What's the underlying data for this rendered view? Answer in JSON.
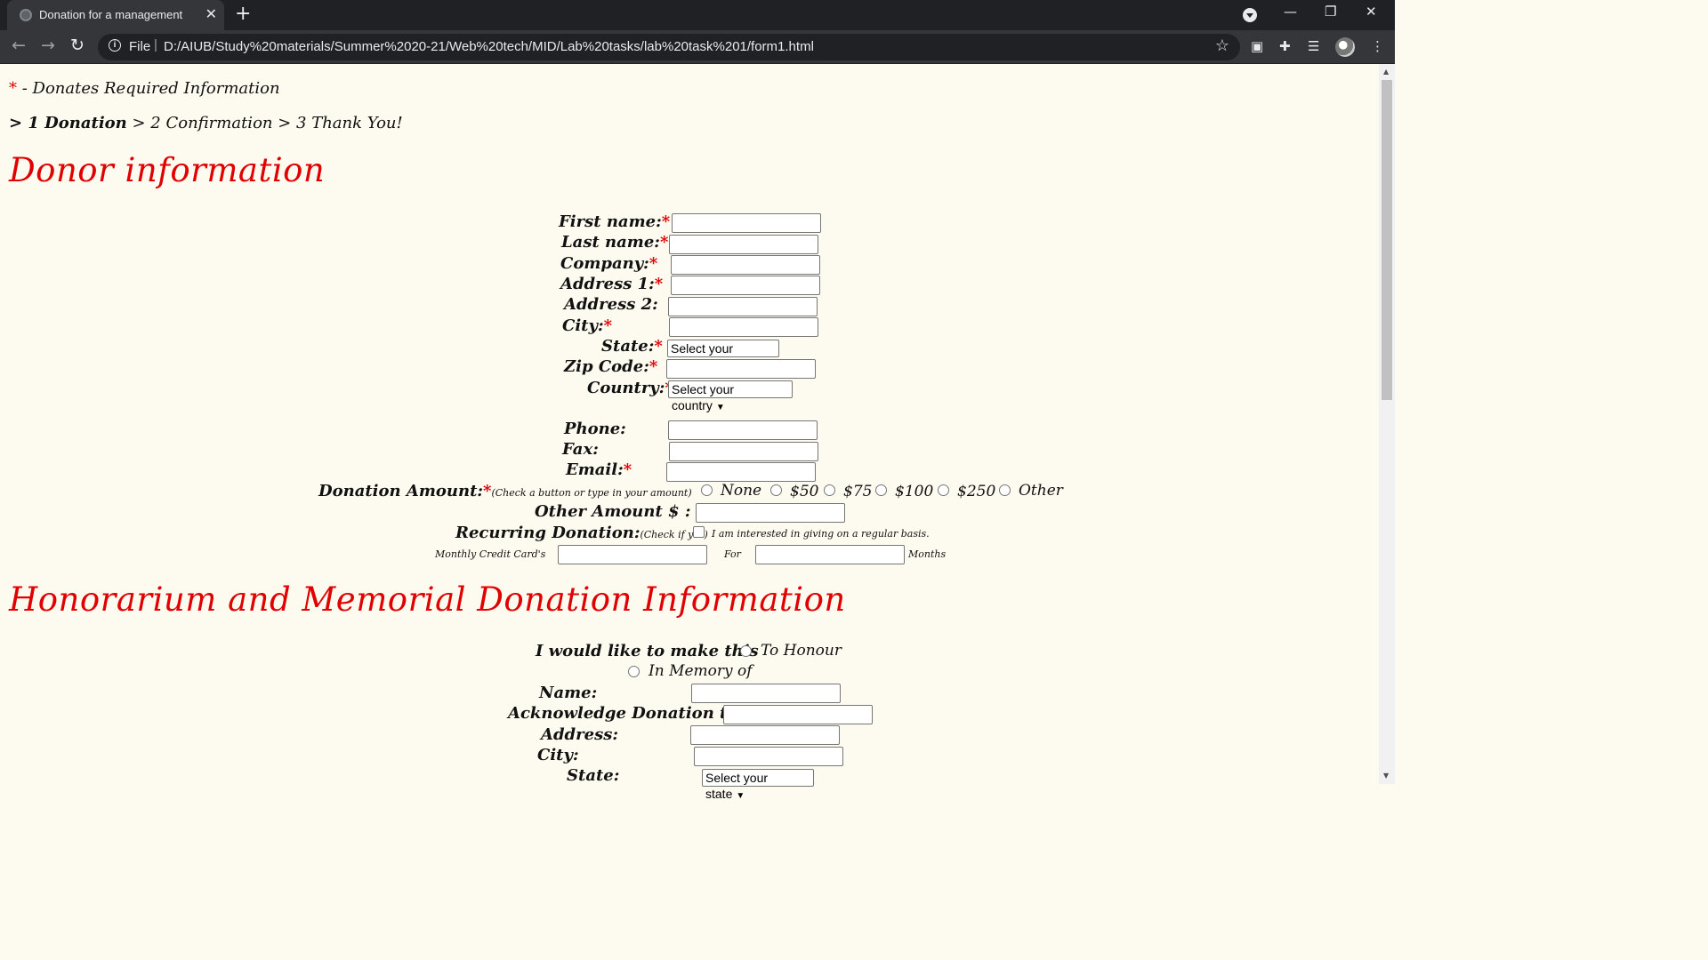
{
  "browser": {
    "tab_title": "Donation for a management",
    "tab_close": "✕",
    "new_tab": "+",
    "scheme": "File",
    "separator": "|",
    "url": "D:/AIUB/Study%20materials/Summer%2020-21/Web%20tech/MID/Lab%20tasks/lab%20task%201/form1.html",
    "minimize": "—",
    "restore": "❐",
    "close": "✕"
  },
  "page": {
    "required_note_star": "*",
    "required_note": " - Donates Required Information",
    "steps": {
      "prefix": "> ",
      "step1": "1 Donation",
      "rest": " > 2 Confirmation > 3 Thank You!"
    },
    "donor_heading": "Donor information",
    "fields": {
      "first_name": "First name:",
      "last_name": "Last name:",
      "company": "Company:",
      "address1": "Address 1:",
      "address2": "Address 2:",
      "city": "City:",
      "state": "State:",
      "zip": "Zip Code:",
      "country": "Country:",
      "phone": "Phone:",
      "fax": "Fax:",
      "email": "Email:"
    },
    "required_star": "*",
    "state_select": "Select your state",
    "country_select": "Select your country",
    "donation_amount_label": "Donation Amount:",
    "donation_amount_hint": "(Check a button or type in your amount)",
    "amount_options": [
      "None",
      "$50",
      "$75",
      "$100",
      "$250",
      "Other"
    ],
    "other_amount_label": "Other Amount $ :",
    "recurring_label": "Recurring Donation:",
    "recurring_hint": "(Check if yes)",
    "recurring_check_text": "I am interested in giving on a regular basis.",
    "monthly_label": "Monthly Credit Card's",
    "for_label": "For",
    "months_label": "Months",
    "honor_heading": "Honorarium and Memorial Donation Information",
    "make_this_label": "I would like to make this",
    "to_honour": "To Honour",
    "in_memory": "In Memory of",
    "hon_name": "Name:",
    "acknowledge": "Acknowledge Donation to:",
    "hon_address": "Address:",
    "hon_city": "City:",
    "hon_state": "State:",
    "hon_state_select": "Select your state"
  }
}
